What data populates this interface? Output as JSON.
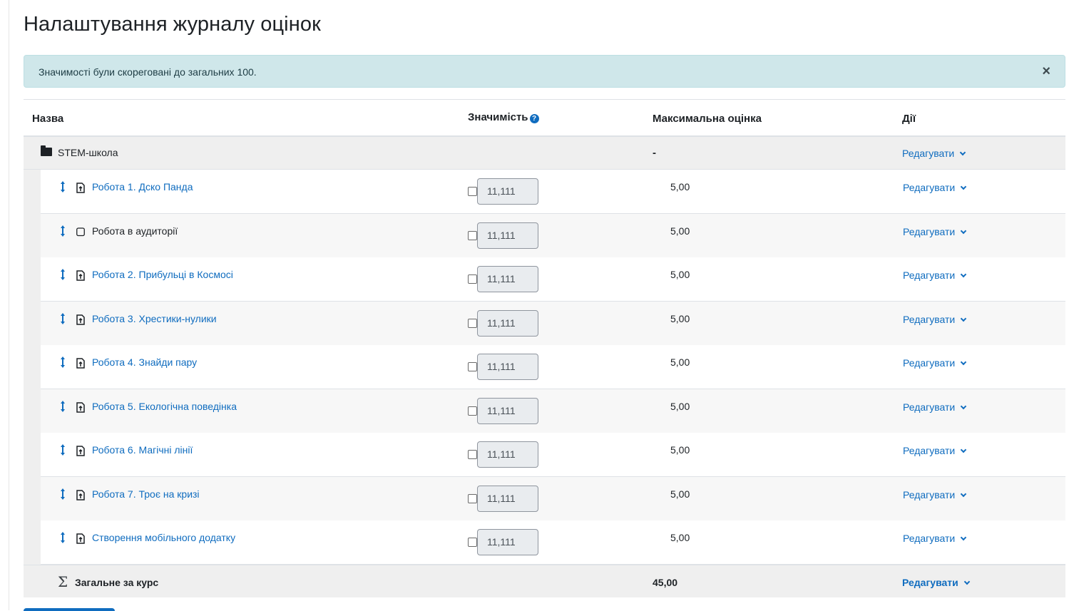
{
  "page": {
    "title": "Налаштування журналу оцінок"
  },
  "alert": {
    "message": "Значимості були скореговані до загальних 100.",
    "close": "×"
  },
  "table": {
    "headers": {
      "name": "Назва",
      "weight": "Значимість",
      "weight_help": "?",
      "max": "Максимальна оцінка",
      "actions": "Дії"
    },
    "category": {
      "name": "STEM-школа",
      "max": "-",
      "action": "Редагувати"
    },
    "items": [
      {
        "name": "Робота 1. Дско Панда",
        "weight": "11,111",
        "max": "5,00",
        "action": "Редагувати",
        "link": true,
        "icon": "assignment-icon"
      },
      {
        "name": "Робота в аудиторії",
        "weight": "11,111",
        "max": "5,00",
        "action": "Редагувати",
        "link": false,
        "icon": "manual-item-icon"
      },
      {
        "name": "Робота 2. Прибульці в Космосі",
        "weight": "11,111",
        "max": "5,00",
        "action": "Редагувати",
        "link": true,
        "icon": "assignment-icon"
      },
      {
        "name": "Робота 3. Хрестики-нулики",
        "weight": "11,111",
        "max": "5,00",
        "action": "Редагувати",
        "link": true,
        "icon": "assignment-icon"
      },
      {
        "name": "Робота 4. Знайди пару",
        "weight": "11,111",
        "max": "5,00",
        "action": "Редагувати",
        "link": true,
        "icon": "assignment-icon"
      },
      {
        "name": "Робота 5. Екологічна поведінка",
        "weight": "11,111",
        "max": "5,00",
        "action": "Редагувати",
        "link": true,
        "icon": "assignment-icon"
      },
      {
        "name": "Робота 6. Магічні лінії",
        "weight": "11,111",
        "max": "5,00",
        "action": "Редагувати",
        "link": true,
        "icon": "assignment-icon"
      },
      {
        "name": "Робота 7. Троє на кризі",
        "weight": "11,111",
        "max": "5,00",
        "action": "Редагувати",
        "link": true,
        "icon": "assignment-icon"
      },
      {
        "name": "Створення мобільного додатку",
        "weight": "11,111",
        "max": "5,00",
        "action": "Редагувати",
        "link": true,
        "icon": "assignment-icon"
      }
    ],
    "total": {
      "symbol": "Σ",
      "name": "Загальне за курс",
      "max": "45,00",
      "action": "Редагувати"
    }
  },
  "colors": {
    "link": "#0f6cbf",
    "alert_bg": "#cfe7ea",
    "row_alt": "#f7f7f7",
    "category_bg": "#efefef"
  }
}
